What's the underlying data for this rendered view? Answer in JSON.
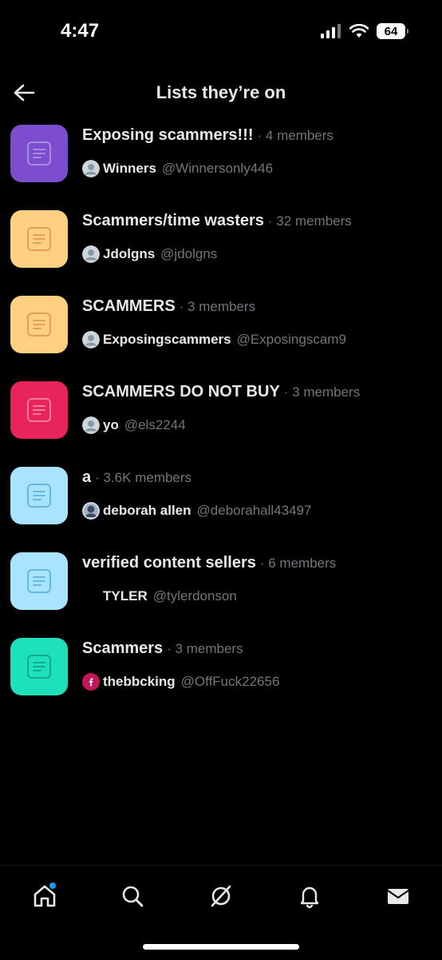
{
  "status_bar": {
    "time": "4:47",
    "battery": "64"
  },
  "header": {
    "title": "Lists they’re on"
  },
  "lists": [
    {
      "name": "Exposing scammers!!!",
      "members": "· 4 members",
      "owner_name": "Winners",
      "owner_handle": "@Winnersonly446",
      "icon_color": "#7c4dcf",
      "avatar": "default"
    },
    {
      "name": "Scammers/time wasters",
      "members": "· 32 members",
      "owner_name": "Jdolgns",
      "owner_handle": "@jdolgns",
      "icon_color": "#ffd082",
      "avatar": "default"
    },
    {
      "name": "SCAMMERS",
      "members": "· 3 members",
      "owner_name": "Exposingscammers",
      "owner_handle": "@Exposingscam9",
      "icon_color": "#ffd082",
      "avatar": "default"
    },
    {
      "name": "SCAMMERS DO NOT BUY",
      "members": "· 3 members",
      "owner_name": "yo",
      "owner_handle": "@els2244",
      "icon_color": "#e8245d",
      "avatar": "default"
    },
    {
      "name": "a",
      "members": "· 3.6K members",
      "owner_name": "deborah allen",
      "owner_handle": "@deborahall43497",
      "icon_color": "#a8e3ff",
      "avatar": "photo"
    },
    {
      "name": "verified content sellers",
      "members": "· 6 members",
      "owner_name": "TYLER",
      "owner_handle": "@tylerdonson",
      "icon_color": "#a8e3ff",
      "avatar": "none"
    },
    {
      "name": "Scammers",
      "members": "· 3 members",
      "owner_name": "thebbcking",
      "owner_handle": "@OffFuck22656",
      "icon_color": "#1ee0ba",
      "avatar": "letter"
    }
  ],
  "icons": {
    "back": "arrow-left-icon",
    "list": "list-icon",
    "nav": [
      "home-icon",
      "search-icon",
      "grok-icon",
      "bell-icon",
      "mail-icon"
    ]
  },
  "colors": {
    "accent": "#1d9bf0",
    "muted": "#71767b",
    "text": "#e7e9ea",
    "background": "#000000"
  }
}
